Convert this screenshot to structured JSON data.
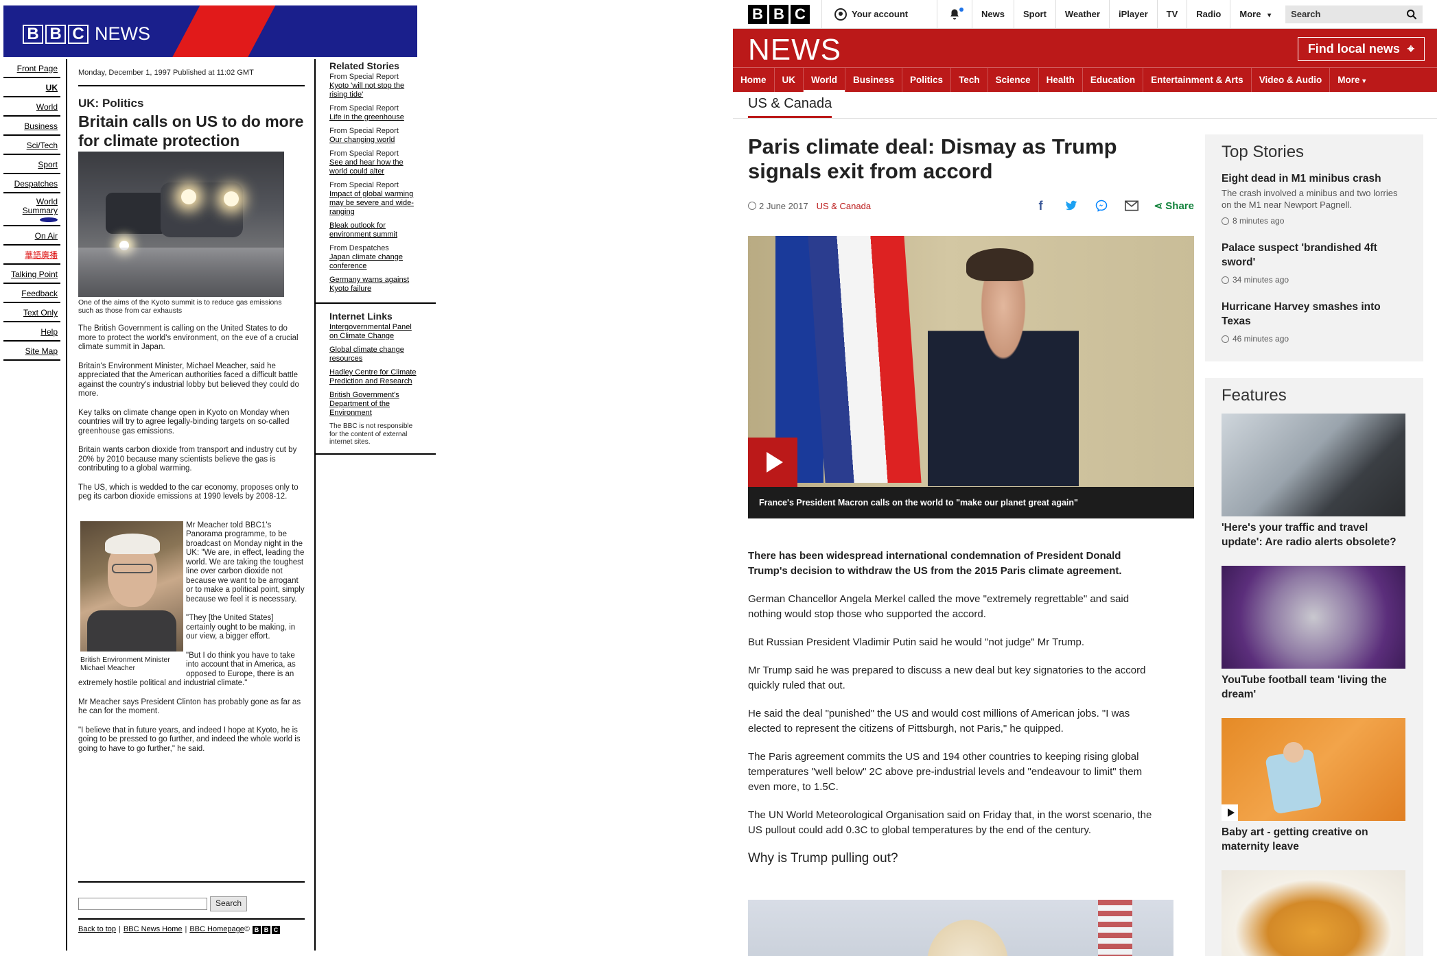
{
  "old_page": {
    "logo_letters": [
      "B",
      "B",
      "C"
    ],
    "logo_word": "NEWS",
    "nav": [
      {
        "label": "Front Page",
        "bold": false
      },
      {
        "label": "UK",
        "bold": true
      },
      {
        "label": "World",
        "bold": false
      },
      {
        "label": "Business",
        "bold": false
      },
      {
        "label": "Sci/Tech",
        "bold": false
      },
      {
        "label": "Sport",
        "bold": false
      },
      {
        "label": "Despatches",
        "bold": false
      },
      {
        "label": "World Summary",
        "bold": false
      },
      {
        "label": "On Air",
        "bold": false
      },
      {
        "label": "華語廣播",
        "bold": false
      },
      {
        "label": "Talking Point",
        "bold": false
      },
      {
        "label": "Feedback",
        "bold": false
      },
      {
        "label": "Text Only",
        "bold": false
      },
      {
        "label": "Help",
        "bold": false
      },
      {
        "label": "Site Map",
        "bold": false
      }
    ],
    "dateline": "Monday, December 1, 1997 Published at 11:02 GMT",
    "section": "UK: Politics",
    "headline": "Britain calls on US to do more for climate protection",
    "photo_caption": "One of the aims of the Kyoto summit is to reduce gas emissions such as those from car exhausts",
    "paragraphs_top": [
      "The British Government is calling on the United States to do more to protect the world's environment, on the eve of a crucial climate summit in Japan.",
      "Britain's Environment Minister, Michael Meacher, said he appreciated that the American authorities faced a difficult battle against the country's industrial lobby but believed they could do more.",
      "Key talks on climate change open in Kyoto on Monday when countries will try to agree legally-binding targets on so-called greenhouse gas emissions.",
      "Britain wants carbon dioxide from transport and industry cut by 20% by 2010 because many scientists believe the gas is contributing to a global warming.",
      "The US, which is wedded to the car economy, proposes only to peg its carbon dioxide emissions at 1990 levels by 2008-12."
    ],
    "inline_caption": "British Environment Minister Michael Meacher",
    "paragraphs_wrap": [
      "Mr Meacher told BBC1's Panorama programme, to be broadcast on Monday night in the UK: \"We are, in effect, leading the world. We are taking the toughest line over carbon dioxide not because we want to be arrogant or to make a political point, simply because we feel it is necessary.",
      "\"They [the United States] certainly ought to be making, in our view, a bigger effort.",
      "\"But I do think you have to take into account that in America, as opposed to Europe, there is an extremely hostile political and industrial climate.\"",
      "Mr Meacher says President Clinton has probably gone as far as he can for the moment.",
      "\"I believe that in future years, and indeed I hope at Kyoto, he is going to be pressed to go further, and indeed the whole world is going to have to go further,\" he said."
    ],
    "search_button": "Search",
    "footer_links": [
      "Back to top",
      "BBC News Home",
      "BBC Homepage"
    ],
    "footer_copyright": "©",
    "related_title": "Related Stories",
    "related": [
      {
        "source": "From Special Report",
        "link": "Kyoto 'will not stop the rising tide'"
      },
      {
        "source": "From Special Report",
        "link": "Life in the greenhouse"
      },
      {
        "source": "From Special Report",
        "link": "Our changing world"
      },
      {
        "source": "From Special Report",
        "link": "See and hear how the world could alter"
      },
      {
        "source": "From Special Report",
        "link": "Impact of global warming may be severe and wide-ranging"
      },
      {
        "source": "",
        "link": "Bleak outlook for environment summit"
      },
      {
        "source": "From Despatches",
        "link": "Japan climate change conference"
      },
      {
        "source": "",
        "link": "Germany warns against Kyoto failure"
      }
    ],
    "internet_title": "Internet Links",
    "internet": [
      "Intergovernmental Panel on Climate Change",
      "Global climate change resources",
      "Hadley Centre for Climate Prediction and Research",
      "British Government's Department of the Environment"
    ],
    "disclaimer": "The BBC is not responsible for the content of external internet sites."
  },
  "new_page": {
    "colors": {
      "brand_red": "#bb1919",
      "share_green": "#11823b"
    },
    "bbc_letters": [
      "B",
      "B",
      "C"
    ],
    "account_label": "Your account",
    "top_links": [
      "News",
      "Sport",
      "Weather",
      "iPlayer",
      "TV",
      "Radio",
      "More"
    ],
    "search_label": "Search",
    "masthead": "NEWS",
    "find_local": "Find local news",
    "nav": [
      "Home",
      "UK",
      "World",
      "Business",
      "Politics",
      "Tech",
      "Science",
      "Health",
      "Education",
      "Entertainment & Arts",
      "Video & Audio",
      "More"
    ],
    "active_nav": "World",
    "subsection": "US & Canada",
    "headline": "Paris climate deal: Dismay as Trump signals exit from accord",
    "date": "2 June 2017",
    "section_link": "US & Canada",
    "share_label": "Share",
    "hero_caption": "France's President Macron calls on the world to \"make our planet great again\"",
    "lead": "There has been widespread international condemnation of President Donald Trump's decision to withdraw the US from the 2015 Paris climate agreement.",
    "paragraphs": [
      "German Chancellor Angela Merkel called the move \"extremely regrettable\" and said nothing would stop those who supported the accord.",
      "But Russian President Vladimir Putin said he would \"not judge\" Mr Trump.",
      "Mr Trump said he was prepared to discuss a new deal but key signatories to the accord quickly ruled that out.",
      "He said the deal \"punished\" the US and would cost millions of American jobs. \"I was elected to represent the citizens of Pittsburgh, not Paris,\" he quipped.",
      "The Paris agreement commits the US and 194 other countries to keeping rising global temperatures \"well below\" 2C above pre-industrial levels and \"endeavour to limit\" them even more, to 1.5C.",
      "The UN World Meteorological Organisation said on Friday that, in the worst scenario, the US pullout could add 0.3C to global temperatures by the end of the century."
    ],
    "subheading": "Why is Trump pulling out?",
    "top_stories_title": "Top Stories",
    "top_stories": [
      {
        "headline": "Eight dead in M1 minibus crash",
        "summary": "The crash involved a minibus and two lorries on the M1 near Newport Pagnell.",
        "time": "8 minutes ago"
      },
      {
        "headline": "Palace suspect 'brandished 4ft sword'",
        "summary": "",
        "time": "34 minutes ago"
      },
      {
        "headline": "Hurricane Harvey smashes into Texas",
        "summary": "",
        "time": "46 minutes ago"
      }
    ],
    "features_title": "Features",
    "features": [
      {
        "headline": "'Here's your traffic and travel update': Are radio alerts obsolete?",
        "img": "car",
        "video": false
      },
      {
        "headline": "YouTube football team 'living the dream'",
        "img": "yt",
        "video": false
      },
      {
        "headline": "Baby art - getting creative on maternity leave",
        "img": "baby",
        "video": true
      },
      {
        "headline": "",
        "img": "food",
        "video": false
      }
    ]
  }
}
